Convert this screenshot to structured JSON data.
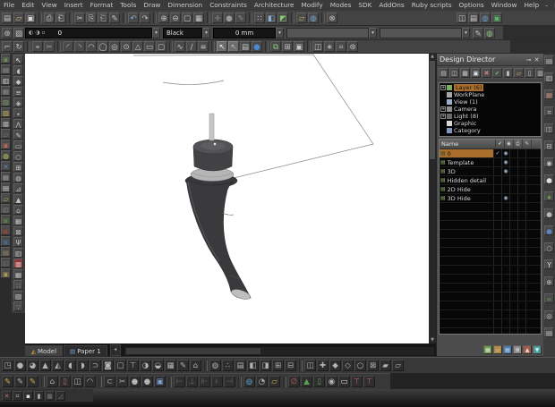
{
  "window": {
    "controls": {
      "minimize": "–",
      "maximize": "□",
      "close": "✕"
    }
  },
  "menu": {
    "items": [
      "File",
      "Edit",
      "View",
      "Insert",
      "Format",
      "Tools",
      "Draw",
      "Dimension",
      "Constraints",
      "Architecture",
      "Modify",
      "Modes",
      "SDK",
      "AddOns",
      "Ruby scripts",
      "Options",
      "Window",
      "Help"
    ]
  },
  "toolbar_standard": {
    "icons": [
      {
        "n": "new-document-icon",
        "g": "▤"
      },
      {
        "n": "open-file-icon",
        "g": "▱",
        "c": "#d2b878"
      },
      {
        "n": "save-icon",
        "g": "▣",
        "c": "#d8d8d8"
      },
      {
        "sep": true
      },
      {
        "n": "print-icon",
        "g": "⎙"
      },
      {
        "n": "print-preview-icon",
        "g": "⎗"
      },
      {
        "sep": true
      },
      {
        "n": "cut-icon",
        "g": "✂"
      },
      {
        "n": "copy-icon",
        "g": "⎘"
      },
      {
        "n": "paste-icon",
        "g": "⎗",
        "c": "#a0a0a0"
      },
      {
        "n": "format-painter-icon",
        "g": "✎"
      },
      {
        "sep": true
      },
      {
        "n": "undo-icon",
        "g": "↶",
        "c": "#8ab0d8"
      },
      {
        "n": "redo-icon",
        "g": "↷"
      },
      {
        "sep": true
      },
      {
        "n": "zoom-in-icon",
        "g": "⊕"
      },
      {
        "n": "zoom-out-icon",
        "g": "⊖"
      },
      {
        "n": "zoom-window-icon",
        "g": "▢"
      },
      {
        "n": "zoom-extents-icon",
        "g": "▦"
      },
      {
        "sep": true
      },
      {
        "n": "pan-icon",
        "g": "✛",
        "c": "#8a8a8a"
      },
      {
        "n": "render-sphere-icon",
        "g": "●",
        "c": "#9a9a9a"
      },
      {
        "n": "pen-style-icon",
        "g": "✎",
        "c": "#8a8a8a"
      },
      {
        "sep": true
      },
      {
        "n": "snap-points-icon",
        "g": "∷"
      },
      {
        "n": "workplane-icon",
        "g": "◧",
        "c": "#8ab0d8"
      },
      {
        "n": "solid-cube-icon",
        "g": "◩",
        "c": "#8ac878"
      },
      {
        "sep": true
      },
      {
        "n": "drawing-folder-icon",
        "g": "▱",
        "c": "#d2b060"
      },
      {
        "n": "web-publish-icon",
        "g": "◍",
        "c": "#78a8d8"
      },
      {
        "sep": true
      },
      {
        "n": "close-drawing-icon",
        "g": "⊗"
      }
    ],
    "right_icons": [
      {
        "n": "palette-panel-icon",
        "g": "◫"
      },
      {
        "n": "library-panel-icon",
        "g": "▤",
        "c": "#d0d0d0"
      },
      {
        "n": "internet-palette-icon",
        "g": "◍",
        "c": "#6a9ad0"
      },
      {
        "n": "materials-panel-icon",
        "g": "▣",
        "c": "#5ab06a"
      }
    ]
  },
  "property_bar": {
    "settings_icon": {
      "n": "settings-gear-icon",
      "g": "⊛"
    },
    "style_icon": {
      "n": "style-manager-icon",
      "g": "▨"
    },
    "pen_combo": {
      "icons": [
        "◐",
        "◑",
        "▫"
      ],
      "value": "0"
    },
    "color_combo": {
      "value": "Black"
    },
    "width_combo": {
      "value": "0 mm"
    },
    "extra_combo_1": {
      "value": ""
    },
    "extra_combo_2": {
      "value": ""
    },
    "edit_icon": {
      "n": "edit-style-icon",
      "g": "✎"
    },
    "render_icon": {
      "n": "render-settings-icon",
      "g": "◍",
      "c": "#8ac878"
    },
    "arrow": "▾"
  },
  "drawing_toolbar": {
    "icons": [
      {
        "n": "edit-tool-icon",
        "g": "⌐"
      },
      {
        "n": "rotate-view-icon",
        "g": "↻"
      },
      {
        "sep": true
      },
      {
        "n": "snap-magnet-icon",
        "g": "⌖"
      },
      {
        "n": "trim-icon",
        "g": "✂",
        "c": "#9a9a9a"
      },
      {
        "sep": true
      },
      {
        "n": "arc-start-icon",
        "g": "◜"
      },
      {
        "n": "arc-end-icon",
        "g": "◝"
      },
      {
        "n": "arc-icon",
        "g": "◠"
      },
      {
        "n": "circle-icon",
        "g": "◯"
      },
      {
        "n": "concentric-circle-icon",
        "g": "◎"
      },
      {
        "n": "ellipse-icon",
        "g": "⊙"
      },
      {
        "n": "polygon-icon",
        "g": "△"
      },
      {
        "n": "rectangle-icon",
        "g": "▭"
      },
      {
        "n": "rounded-rectangle-icon",
        "g": "▢"
      },
      {
        "sep": true
      },
      {
        "n": "spline-icon",
        "g": "∿"
      },
      {
        "n": "line-icon",
        "g": "∕"
      },
      {
        "n": "polyline-icon",
        "g": "≡"
      },
      {
        "sep": true
      },
      {
        "n": "select-cursor-icon",
        "g": "↖",
        "c": "#f2f2f2",
        "on": true
      },
      {
        "n": "select-alt-cursor-icon",
        "g": "↖",
        "c": "#b8b8b8",
        "on": true
      },
      {
        "n": "page-setup-icon",
        "g": "▤",
        "c": "#c8c8c8"
      },
      {
        "n": "render-mode-icon",
        "g": "●",
        "c": "#4a8ad0"
      },
      {
        "sep": true
      },
      {
        "n": "copy-entities-icon",
        "g": "⧉",
        "c": "#8ac878"
      },
      {
        "n": "array-copy-icon",
        "g": "⊞"
      },
      {
        "n": "group-icon",
        "g": "▣"
      },
      {
        "sep": true
      },
      {
        "n": "mirror-icon",
        "g": "◫"
      },
      {
        "n": "explode-icon",
        "g": "∗"
      },
      {
        "n": "measure-icon",
        "g": "⌗"
      },
      {
        "n": "options-icon",
        "g": "⊛"
      }
    ]
  },
  "left_toolbar_outer": {
    "icons": [
      {
        "n": "image-tool-icon",
        "g": "▣",
        "c": "#6a8a5a"
      },
      {
        "n": "picture-tool-icon",
        "g": "▤",
        "c": "#9a9a9a"
      },
      {
        "n": "page-white-icon",
        "g": "▥",
        "c": "#d8d8d8"
      },
      {
        "n": "photo-tool-icon",
        "g": "▦",
        "c": "#8a8a8a"
      },
      {
        "n": "scene-tool-icon",
        "g": "▧",
        "c": "#7a9a6a"
      },
      {
        "n": "yellow-tool-icon",
        "g": "▨",
        "c": "#c8b858"
      },
      {
        "n": "monitor-tool-icon",
        "g": "▩",
        "c": "#b0b0b0"
      },
      {
        "n": "folder-tool-icon",
        "g": "▱",
        "c": "#8a7a5a"
      },
      {
        "n": "palette-tool-icon",
        "g": "▣",
        "c": "#b06a5a"
      },
      {
        "n": "bulb-tool-icon",
        "g": "◍",
        "c": "#c8c858"
      },
      {
        "n": "blue-x-tool-icon",
        "g": "✕",
        "c": "#6a8ac8"
      },
      {
        "n": "checker-tool-icon",
        "g": "▦",
        "c": "#9a9a9a"
      },
      {
        "n": "doc-tool-icon",
        "g": "▤",
        "c": "#d8d8d8"
      },
      {
        "n": "folder2-tool-icon",
        "g": "▱",
        "c": "#c8a858"
      },
      {
        "n": "film-tool-icon",
        "g": "▥",
        "c": "#7a7a7a"
      },
      {
        "n": "green-tool-icon",
        "g": "▣",
        "c": "#5a7a4a"
      },
      {
        "n": "red-tool-icon",
        "g": "▣",
        "c": "#8a4a3a"
      },
      {
        "n": "blue-tool-icon",
        "g": "▣",
        "c": "#4a6a8a"
      },
      {
        "n": "tan-tool-icon",
        "g": "▤",
        "c": "#9a8a6a"
      },
      {
        "n": "gray-tool-icon",
        "g": "▥",
        "c": "#6a6a6a"
      },
      {
        "n": "olive-tool-icon",
        "g": "▣",
        "c": "#aa9a5a"
      }
    ]
  },
  "left_toolbar_inner": {
    "icons": [
      {
        "n": "select-arrow-icon",
        "g": "↖",
        "c": "#f0f0f0"
      },
      {
        "n": "orbit-tool-icon",
        "g": "◖"
      },
      {
        "n": "node-edit-icon",
        "g": "◆"
      },
      {
        "n": "layers-list-icon",
        "g": "≡"
      },
      {
        "n": "diamond-snap-icon",
        "g": "◈"
      },
      {
        "n": "point-tool-icon",
        "g": "∙"
      },
      {
        "n": "angle-tool-icon",
        "g": "⋀"
      },
      {
        "n": "sketch-tool-icon",
        "g": "✎"
      },
      {
        "n": "rect-tool-icon",
        "g": "▭"
      },
      {
        "n": "circle-tool-icon",
        "g": "○"
      },
      {
        "n": "grid-plus-icon",
        "g": "⊞"
      },
      {
        "n": "sphere-wire-icon",
        "g": "◍"
      },
      {
        "n": "triangle-tool-icon",
        "g": "⊿"
      },
      {
        "n": "cone-tool-icon",
        "g": "▲"
      },
      {
        "n": "house-tool-icon",
        "g": "⌂"
      },
      {
        "n": "mesh-tool-icon",
        "g": "▦"
      },
      {
        "n": "crossbox-tool-icon",
        "g": "⊠"
      },
      {
        "n": "lamp-tool-icon",
        "g": "Ψ"
      },
      {
        "n": "panel-tool-icon",
        "g": "▥"
      },
      {
        "n": "record-tool-icon",
        "g": "▩",
        "c": "#e0b0b0",
        "bg": "#8a3a3a"
      },
      {
        "n": "grid2-tool-icon",
        "g": "▦"
      },
      {
        "n": "dots-tool-icon",
        "g": "∷"
      },
      {
        "n": "hatch-tool-icon",
        "g": "▧"
      },
      {
        "n": "because-tool-icon",
        "g": "∵"
      }
    ]
  },
  "right_toolbar": {
    "icons": [
      {
        "n": "views-panel-icon",
        "g": "▤"
      },
      {
        "n": "keyboard-panel-icon",
        "g": "▥"
      },
      {
        "n": "red-panel-icon",
        "g": "▦",
        "c": "#c08a7a"
      },
      {
        "n": "hatch-panel-icon",
        "g": "⌗"
      },
      {
        "n": "split-panel-icon",
        "g": "◫"
      },
      {
        "n": "minus-grid-icon",
        "g": "⊟"
      },
      {
        "n": "target-icon",
        "g": "◉"
      },
      {
        "n": "white-sphere-icon",
        "g": "●",
        "c": "#e0e0e0"
      },
      {
        "n": "plant-icon",
        "g": "∗",
        "c": "#7ab55a"
      },
      {
        "n": "gray-sphere-icon",
        "g": "●",
        "c": "#b8b8b8"
      },
      {
        "n": "blue-sphere-icon",
        "g": "●",
        "c": "#5a85c0"
      },
      {
        "n": "ring-icon",
        "g": "○"
      },
      {
        "n": "funnel-icon",
        "g": "Y",
        "c": "#e0e0e0"
      },
      {
        "n": "plus-circle-icon",
        "g": "⊕"
      },
      {
        "n": "infinity-icon",
        "g": "∞",
        "c": "#6aa05a"
      },
      {
        "n": "bullseye-icon",
        "g": "◎"
      },
      {
        "n": "list-panel-icon",
        "g": "▤"
      }
    ]
  },
  "design_director": {
    "title": "Design Director",
    "pin_icon": "⊸",
    "close_icon": "✕",
    "toolbar": [
      {
        "n": "dd-list-view-icon",
        "g": "▤"
      },
      {
        "n": "dd-split-view-icon",
        "g": "◫"
      },
      {
        "n": "dd-grid-view-icon",
        "g": "▦"
      },
      {
        "n": "dd-new-item-icon",
        "g": "▣",
        "c": "#e0e0e0"
      },
      {
        "n": "dd-delete-item-icon",
        "g": "✖",
        "c": "#c87a7a"
      },
      {
        "n": "dd-apply-icon",
        "g": "✔",
        "c": "#7ab06a"
      },
      {
        "n": "dd-bar-left-icon",
        "g": "▮"
      },
      {
        "n": "dd-folder-icon",
        "g": "▱",
        "c": "#d0b060"
      },
      {
        "n": "dd-bar-right-icon",
        "g": "▯"
      },
      {
        "n": "dd-columns-icon",
        "g": "▥"
      }
    ],
    "tree": [
      {
        "label": "Layer (6)",
        "icon_color": "#7ab05a",
        "expand": true,
        "selected": true
      },
      {
        "label": "WorkPlane",
        "icon_color": "#a8a8a8"
      },
      {
        "label": "View (1)",
        "icon_color": "#9ab0c8"
      },
      {
        "label": "Camera",
        "icon_color": "#909090",
        "expand": true
      },
      {
        "label": "Light (8)",
        "icon_color": "#6a6a6a",
        "expand": true
      },
      {
        "label": "Graphic",
        "icon_color": "#d8d8d8"
      },
      {
        "label": "Category",
        "icon_color": "#8098c0"
      }
    ],
    "table": {
      "name_header": "Name",
      "column_icons": [
        {
          "n": "check-column-icon",
          "g": "✔"
        },
        {
          "n": "visibility-column-icon",
          "g": "◉"
        },
        {
          "n": "print-column-icon",
          "g": "⎙"
        },
        {
          "n": "edit-column-icon",
          "g": "✎"
        }
      ],
      "rows": [
        {
          "name": "0",
          "selected": true,
          "check": true,
          "eye": true
        },
        {
          "name": "Template",
          "check": false,
          "eye": true
        },
        {
          "name": "3D",
          "check": false,
          "eye": true
        },
        {
          "name": "Hidden detail",
          "check": false,
          "eye": false
        },
        {
          "name": "2D Hide",
          "check": false,
          "eye": false
        },
        {
          "name": "3D Hide",
          "check": false,
          "eye": true
        }
      ],
      "empty_row_count": 15,
      "check_glyph": "✓",
      "eye_glyph": "◉",
      "row_icon": "▤"
    },
    "bottom_icons": [
      {
        "n": "dd-layer-new-icon",
        "g": "▦",
        "bg": "#6a9a4a",
        "c": "#dfe8d0"
      },
      {
        "n": "dd-layer-folder-icon",
        "g": "▱",
        "bg": "#b08a4a",
        "c": "#f0e4cc"
      },
      {
        "n": "dd-layer-filter-icon",
        "g": "▤",
        "bg": "#4a7ab0",
        "c": "#d8e4f0"
      },
      {
        "n": "dd-layer-settings-icon",
        "g": "⊛",
        "bg": "#8a8a8a",
        "c": "#ededed"
      },
      {
        "n": "dd-layer-up-icon",
        "g": "▲",
        "bg": "#a05a4a",
        "c": "#f0dcd4"
      },
      {
        "n": "dd-layer-down-icon",
        "g": "▼",
        "bg": "#4a9a9a",
        "c": "#d4ecec"
      }
    ]
  },
  "tabs": {
    "items": [
      {
        "label": "Model",
        "icon": "◭",
        "icon_color": "#d09a40",
        "active": true
      },
      {
        "label": "Paper 1",
        "icon": "▤",
        "icon_color": "#78a8d8",
        "active": false
      }
    ],
    "nav": "◂"
  },
  "bottom_toolbar_1": {
    "icons": [
      {
        "n": "box-3d-icon",
        "g": "◳"
      },
      {
        "n": "sphere-3d-icon",
        "g": "●"
      },
      {
        "n": "dome-3d-icon",
        "g": "◕"
      },
      {
        "n": "cone-3d-icon",
        "g": "▲"
      },
      {
        "n": "wedge-3d-icon",
        "g": "◭"
      },
      {
        "n": "half-torus-icon",
        "g": "◖"
      },
      {
        "n": "torus-icon",
        "g": "◗"
      },
      {
        "n": "sweep-icon",
        "g": "⊃"
      },
      {
        "n": "extrude-icon",
        "g": "◙"
      },
      {
        "n": "slab-icon",
        "g": "▢"
      },
      {
        "n": "hammer-tool-icon",
        "g": "⊤"
      },
      {
        "n": "shaded-sphere-icon",
        "g": "◑"
      },
      {
        "n": "half-shade-icon",
        "g": "◒"
      },
      {
        "n": "mesh-3d-icon",
        "g": "▦"
      },
      {
        "n": "draft-pen-icon",
        "g": "✎"
      },
      {
        "n": "house-3d-icon",
        "g": "⌂"
      },
      {
        "sep": true
      },
      {
        "n": "globe-render-icon",
        "g": "◍"
      },
      {
        "n": "points-cloud-icon",
        "g": "∴"
      },
      {
        "n": "panel-3d-icon",
        "g": "▤"
      },
      {
        "n": "half-left-icon",
        "g": "◧"
      },
      {
        "n": "half-right-icon",
        "g": "◨"
      },
      {
        "n": "grid-plus-3d-icon",
        "g": "⊞"
      },
      {
        "n": "grid-minus-3d-icon",
        "g": "⊟"
      },
      {
        "sep": true
      },
      {
        "n": "twin-view-icon",
        "g": "◫"
      },
      {
        "n": "add-solid-icon",
        "g": "✚"
      },
      {
        "n": "solid-diamond-icon",
        "g": "◆"
      },
      {
        "n": "wire-diamond-icon",
        "g": "◇"
      },
      {
        "n": "circle-3d-icon",
        "g": "○"
      },
      {
        "n": "crossed-box-icon",
        "g": "⊠"
      },
      {
        "n": "bar-solid-icon",
        "g": "▰"
      },
      {
        "n": "bar-wire-icon",
        "g": "▱"
      }
    ]
  },
  "bottom_toolbar_2": {
    "icons": [
      {
        "n": "pen-yellow-icon",
        "g": "✎",
        "c": "#d2b14c"
      },
      {
        "n": "pen-gray-icon",
        "g": "✎"
      },
      {
        "n": "pen-yellow2-icon",
        "g": "✎",
        "c": "#d2b14c"
      },
      {
        "sep": true
      },
      {
        "n": "structure-icon",
        "g": "⌂"
      },
      {
        "n": "lock-red-icon",
        "g": "▯",
        "c": "#c46a6a"
      },
      {
        "n": "wall-icon",
        "g": "◫"
      },
      {
        "n": "arch-icon",
        "g": "◠"
      },
      {
        "sep": true
      },
      {
        "n": "clip-icon",
        "g": "⊂"
      },
      {
        "n": "trim2-icon",
        "g": "✂"
      },
      {
        "n": "node-pen-icon",
        "g": "●"
      },
      {
        "n": "node-pen2-icon",
        "g": "●"
      },
      {
        "n": "frame-blue-icon",
        "g": "▣",
        "c": "#7aa4d8",
        "on": true
      },
      {
        "sep": true
      },
      {
        "n": "dim-left-icon",
        "g": "⊢",
        "c": "#6a6a6a"
      },
      {
        "n": "dim-bottom-icon",
        "g": "⊥",
        "c": "#6a6a6a"
      },
      {
        "n": "dim-multi-icon",
        "g": "⊩",
        "c": "#6a6a6a"
      },
      {
        "n": "dim-single-icon",
        "g": "⊦",
        "c": "#6a6a6a"
      },
      {
        "n": "dim-right-icon",
        "g": "⊣",
        "c": "#6a6a6a"
      },
      {
        "sep": true
      },
      {
        "n": "globe-blue-icon",
        "g": "◍",
        "c": "#5aa0d0"
      },
      {
        "n": "clock-icon",
        "g": "◔"
      },
      {
        "n": "folder-open-icon",
        "g": "▱",
        "c": "#c8a858"
      },
      {
        "sep": true
      },
      {
        "n": "no-entry-icon",
        "g": "∅",
        "c": "#c06060"
      },
      {
        "n": "arrow-up-green-icon",
        "g": "▲",
        "c": "#5aa05a"
      },
      {
        "n": "lock-green-icon",
        "g": "▯",
        "c": "#5aa05a"
      },
      {
        "n": "target2-icon",
        "g": "◉"
      },
      {
        "n": "frame-white-icon",
        "g": "▭",
        "c": "#d8d8d8"
      },
      {
        "n": "pin-red-icon",
        "g": "⊤",
        "c": "#c06a6a"
      },
      {
        "n": "pin-red2-icon",
        "g": "⊤",
        "c": "#c06a6a"
      }
    ]
  },
  "bottom_toolbar_3": {
    "icons": [
      {
        "n": "erase-red-icon",
        "g": "✕",
        "c": "#c87070"
      },
      {
        "n": "hatch-small-icon",
        "g": "⌗"
      },
      {
        "n": "swatch-white-icon",
        "g": "▪",
        "c": "#e0e0e0"
      },
      {
        "n": "bar-small-icon",
        "g": "▮"
      },
      {
        "n": "grid-dim-icon",
        "g": "▦",
        "c": "#7a7a7a"
      },
      {
        "n": "tri-dim-icon",
        "g": "◿",
        "c": "#7a7a7a"
      }
    ]
  }
}
